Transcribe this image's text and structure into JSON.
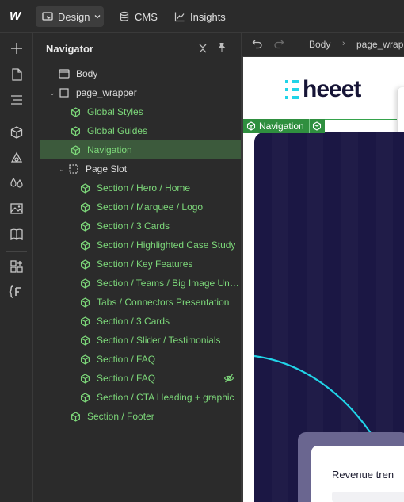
{
  "topbar": {
    "logo": "W",
    "modes": [
      {
        "label": "Design",
        "icon": "design-mode-icon",
        "active": true
      },
      {
        "label": "CMS",
        "icon": "database-icon"
      },
      {
        "label": "Insights",
        "icon": "chart-icon"
      }
    ]
  },
  "rail": {
    "icons": [
      "add-icon",
      "pages-icon",
      "navigator-icon",
      "components-icon",
      "variables-icon",
      "styles-icon",
      "assets-icon",
      "library-icon",
      "apps-icon",
      "code-icon"
    ]
  },
  "navigator": {
    "title": "Navigator",
    "rows": [
      {
        "label": "Body",
        "type": "plain"
      },
      {
        "label": "page_wrapper",
        "type": "plain"
      },
      {
        "label": "Global Styles",
        "type": "comp"
      },
      {
        "label": "Global Guides",
        "type": "comp"
      },
      {
        "label": "Navigation",
        "type": "comp",
        "selected": true
      },
      {
        "label": "Page Slot",
        "type": "plain"
      },
      {
        "label": "Section / Hero / Home",
        "type": "comp"
      },
      {
        "label": "Section / Marquee / Logo",
        "type": "comp"
      },
      {
        "label": "Section / 3 Cards",
        "type": "comp"
      },
      {
        "label": "Section / Highlighted Case Study",
        "type": "comp"
      },
      {
        "label": "Section / Key Features",
        "type": "comp"
      },
      {
        "label": "Section / Teams / Big Image Und...",
        "type": "comp"
      },
      {
        "label": "Tabs / Connectors Presentation",
        "type": "comp"
      },
      {
        "label": "Section / 3 Cards",
        "type": "comp"
      },
      {
        "label": "Section / Slider / Testimonials",
        "type": "comp"
      },
      {
        "label": "Section / FAQ",
        "type": "comp"
      },
      {
        "label": "Section / FAQ",
        "type": "comp",
        "hidden": true
      },
      {
        "label": "Section / CTA Heading + graphic",
        "type": "comp"
      },
      {
        "label": "Section / Footer",
        "type": "comp"
      }
    ]
  },
  "canvas": {
    "breadcrumb": [
      "Body",
      "page_wrap"
    ],
    "brand": "heeet",
    "selected_tag": "Navigation",
    "widget_text": "Revenue tren",
    "accent": "#21d4e8",
    "hero_color": "#1b1744"
  }
}
